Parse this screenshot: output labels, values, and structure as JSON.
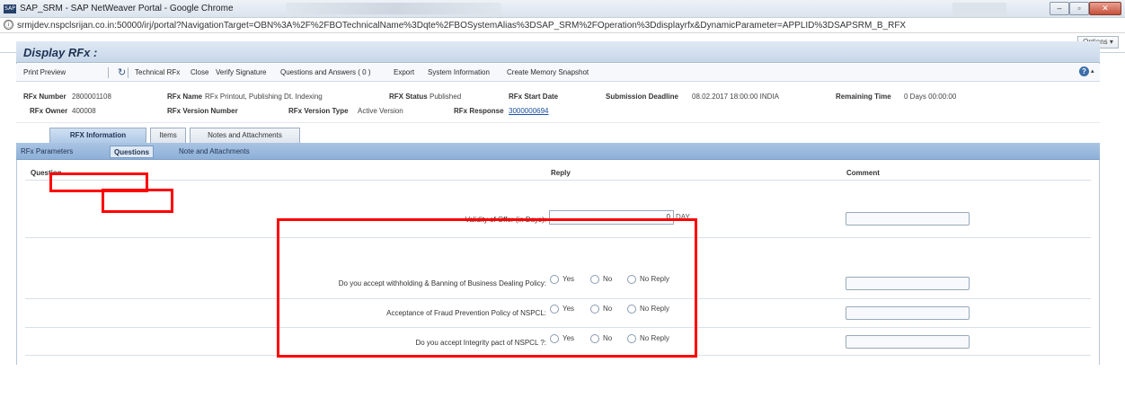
{
  "window": {
    "title": "SAP_SRM - SAP NetWeaver Portal - Google Chrome",
    "app_icon": "chrome-app-icon",
    "controls": {
      "minimize": "–",
      "maximize": "▫",
      "close": "✕"
    }
  },
  "browser": {
    "info_icon": "ⓘ",
    "url": "srmjdev.nspclsrijan.co.in:50000/irj/portal?NavigationTarget=OBN%3A%2F%2FBOTechnicalName%3Dqte%2FBOSystemAlias%3DSAP_SRM%2FOperation%3Ddisplayrfx&DynamicParameter=APPLID%3DSAPSRM_B_RFX"
  },
  "portal": {
    "options_label": "Options ▾"
  },
  "page": {
    "title": "Display RFx :"
  },
  "toolbar": {
    "print_preview": "Print Preview",
    "refresh_icon": "↻",
    "technical_rfx": "Technical RFx",
    "close": "Close",
    "verify_signature": "Verify Signature",
    "questions_and_answers": "Questions and Answers ( 0 )",
    "export": "Export",
    "system_information": "System Information",
    "create_memory_snapshot": "Create Memory Snapshot",
    "help_icon": "?",
    "help_caret": "▴"
  },
  "summary": {
    "rfx_number_label": "RFx Number",
    "rfx_number": "2800001108",
    "rfx_name_label": "RFx Name",
    "rfx_name": "RFx Printout, Publishing Dt. Indexing",
    "rfx_status_label": "RFX Status",
    "rfx_status": "Published",
    "rfx_start_date_label": "RFx Start Date",
    "submission_deadline_label": "Submission Deadline",
    "submission_deadline": "08.02.2017 18:00:00 INDIA",
    "remaining_time_label": "Remaining Time",
    "remaining_time": "0 Days 00:00:00",
    "rfx_owner_label": "RFx Owner",
    "rfx_owner": "400008",
    "rfx_version_number_label": "RFx Version Number",
    "rfx_version_type_label": "RFx Version Type",
    "rfx_version_type": "Active Version",
    "rfx_response_label": "RFx Response",
    "rfx_response": "3000000694"
  },
  "main_tabs": [
    {
      "label": "RFX Information",
      "active": true
    },
    {
      "label": "Items",
      "active": false
    },
    {
      "label": "Notes and Attachments",
      "active": false
    }
  ],
  "sub_tabs": [
    {
      "label": "RFx Parameters",
      "active": false
    },
    {
      "label": "Questions",
      "active": true
    },
    {
      "label": "Note and Attachments",
      "active": false
    }
  ],
  "table": {
    "columns": {
      "question": "Question",
      "reply": "Reply",
      "comment": "Comment"
    },
    "rows": [
      {
        "question": "Validity of Offer (in Days):",
        "value": "0",
        "unit": "DAY"
      },
      {
        "question": "Do you accept withholding & Banning of Business Dealing Policy:",
        "options": [
          "Yes",
          "No",
          "No Reply"
        ]
      },
      {
        "question": "Acceptance of Fraud Prevention Policy of NSPCL:",
        "options": [
          "Yes",
          "No",
          "No Reply"
        ]
      },
      {
        "question": "Do you accept Integrity pact of NSPCL ?:",
        "options": [
          "Yes",
          "No",
          "No Reply"
        ]
      }
    ]
  },
  "colors": {
    "highlight": "#ff0000",
    "tab_bar": "#a9c4e3",
    "header": "#c7d7e9"
  }
}
